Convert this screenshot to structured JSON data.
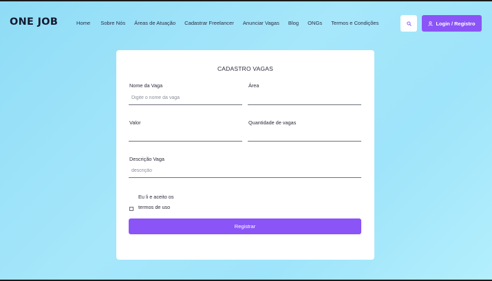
{
  "header": {
    "logo": "ONE JOB",
    "nav": [
      {
        "label": "Home"
      },
      {
        "label": "Sobre Nós"
      },
      {
        "label": "Áreas de Atuação"
      },
      {
        "label": "Cadastrar Freelancer"
      },
      {
        "label": "Anunciar Vagas"
      },
      {
        "label": "Blog"
      },
      {
        "label": "ONGs"
      },
      {
        "label": "Termos e Condições"
      }
    ],
    "search_icon": "search-icon",
    "login_label": "Login / Registro",
    "login_icon": "user-icon"
  },
  "form": {
    "title": "CADASTRO VAGAS",
    "nome_vaga": {
      "label": "Nome da Vaga",
      "placeholder": "Digite o nome da vaga",
      "value": ""
    },
    "area": {
      "label": "Área",
      "placeholder": "",
      "value": ""
    },
    "valor": {
      "label": "Valor",
      "placeholder": "",
      "value": ""
    },
    "quantidade": {
      "label": "Quantidade de vagas",
      "placeholder": "",
      "value": ""
    },
    "descricao": {
      "label": "Descrição Vaga",
      "placeholder": "descrição",
      "value": ""
    },
    "terms_line1": "Eu li e aceito os",
    "terms_line2": "termos de uso",
    "terms_checked": false,
    "submit_label": "Registrar"
  },
  "colors": {
    "accent": "#8b54f7",
    "background": "#a6e7fb",
    "text": "#15192e"
  }
}
